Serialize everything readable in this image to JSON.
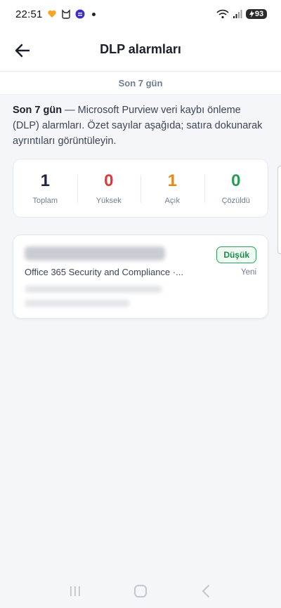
{
  "status_bar": {
    "time": "22:51",
    "battery": "93"
  },
  "app_bar": {
    "title": "DLP alarmları"
  },
  "filter": {
    "label": "Son 7 gün"
  },
  "description": {
    "bold": "Son 7 gün",
    "text": " — Microsoft Purview veri kaybı önleme (DLP) alarmları. Özet sayılar aşağıda; satıra dokunarak ayrıntıları görüntüleyin."
  },
  "summary": {
    "stats": [
      {
        "value": "1",
        "label": "Toplam",
        "color": "#1c2640"
      },
      {
        "value": "0",
        "label": "Yüksek",
        "color": "#d93a3a"
      },
      {
        "value": "1",
        "label": "Açık",
        "color": "#e08a1a"
      },
      {
        "value": "0",
        "label": "Çözüldü",
        "color": "#2a9d55"
      }
    ]
  },
  "alerts": [
    {
      "source": "Office 365  Security and  Compliance ·...",
      "severity": "Düşük",
      "status": "Yeni"
    }
  ],
  "colors": {
    "accent_green": "#2aa35a",
    "background": "#f4f6f9"
  }
}
